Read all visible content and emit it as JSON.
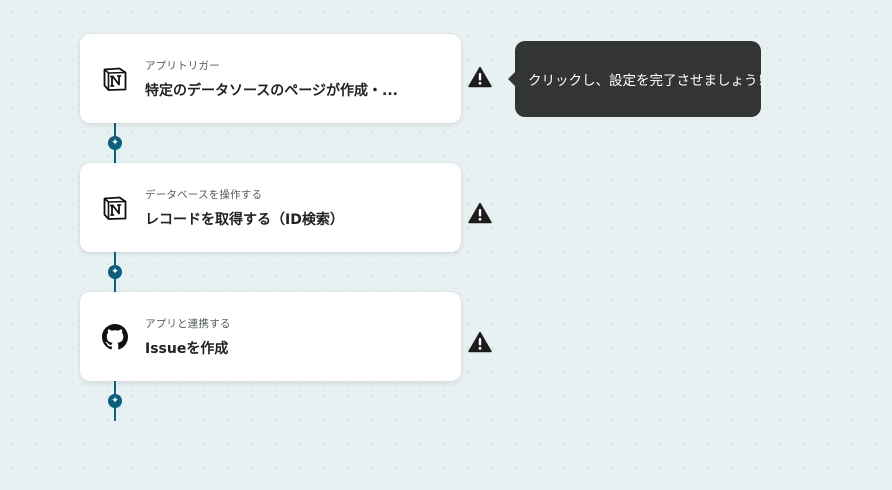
{
  "flow": {
    "steps": [
      {
        "subtitle": "アプリトリガー",
        "title": "特定のデータソースのページが作成・...",
        "app_icon": "notion-icon",
        "status_icon": "warning-icon"
      },
      {
        "subtitle": "データベースを操作する",
        "title": "レコードを取得する（ID検索）",
        "app_icon": "notion-icon",
        "status_icon": "warning-icon"
      },
      {
        "subtitle": "アプリと連携する",
        "title": "Issueを作成",
        "app_icon": "github-icon",
        "status_icon": "warning-icon"
      }
    ],
    "add_step_icon": "plus-icon"
  },
  "tooltip": {
    "text": "クリックし、設定を完了させましょう！"
  },
  "colors": {
    "background": "#e8f1f2",
    "connector": "#0b5f7d",
    "tooltip_bg": "#333434",
    "card_bg": "#ffffff"
  }
}
